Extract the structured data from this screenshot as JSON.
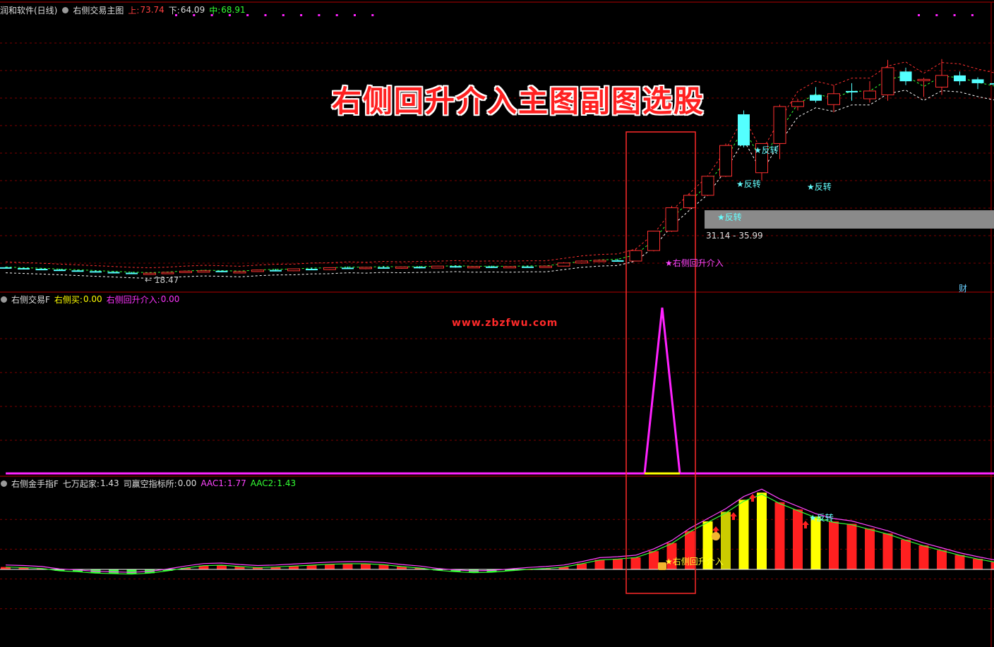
{
  "header": {
    "app_name": "润和软件(日线)",
    "indicator_name": "右侧交易主图",
    "upper_label": "上:",
    "upper_value": "73.74",
    "lower_label": "下:",
    "lower_value": "64.09",
    "mid_label": "中:",
    "mid_value": "68.91"
  },
  "banner": {
    "title": "右侧回升介入主图副图选股"
  },
  "watermark": {
    "text": "www.zbzfwu.com"
  },
  "pane2": {
    "name": "右侧交易F",
    "buy_label": "右侧买:",
    "buy_value": "0.00",
    "rise_label": "右侧回升介入:",
    "rise_value": "0.00"
  },
  "pane3": {
    "name": "右侧金手指F",
    "k1_label": "七万起家:",
    "k1_value": "1.43",
    "k2_label": "司赢空指标所:",
    "k2_value": "0.00",
    "aac1_label": "AAC1:",
    "aac1_value": "1.77",
    "aac2_label": "AAC2:",
    "aac2_value": "1.43"
  },
  "annotations": {
    "low_price": "← 18.47",
    "price_range": "31.14 - 35.99",
    "rise_entry": "★右侧回升介入",
    "reverse": "★反转",
    "cai": "财"
  },
  "colors": {
    "up": "#ff3030",
    "down": "#54ffff",
    "magenta": "#ff22ff",
    "yellow": "#ffff00",
    "grid": "#7a0000"
  },
  "chart_data": [
    {
      "type": "candlestick",
      "title": "右侧交易主图",
      "candles": [
        [
          20.2,
          20.3,
          19.9,
          20.0
        ],
        [
          20.0,
          20.1,
          19.7,
          19.8
        ],
        [
          19.8,
          20.0,
          19.5,
          19.6
        ],
        [
          19.6,
          19.8,
          19.3,
          19.4
        ],
        [
          19.4,
          19.6,
          19.1,
          19.2
        ],
        [
          19.2,
          19.4,
          18.9,
          19.0
        ],
        [
          19.0,
          19.2,
          18.7,
          18.8
        ],
        [
          18.8,
          19.0,
          18.5,
          18.6
        ],
        [
          18.6,
          18.8,
          18.47,
          18.7
        ],
        [
          18.7,
          19.0,
          18.6,
          18.9
        ],
        [
          18.9,
          19.3,
          18.8,
          19.2
        ],
        [
          19.2,
          19.5,
          19.0,
          19.3
        ],
        [
          19.3,
          19.4,
          18.9,
          19.0
        ],
        [
          19.0,
          19.2,
          18.8,
          19.1
        ],
        [
          19.1,
          19.6,
          19.0,
          19.5
        ],
        [
          19.5,
          19.8,
          19.2,
          19.3
        ],
        [
          19.3,
          19.9,
          19.2,
          19.8
        ],
        [
          19.8,
          20.1,
          19.5,
          19.6
        ],
        [
          19.6,
          20.2,
          19.5,
          20.1
        ],
        [
          20.1,
          20.4,
          19.8,
          19.9
        ],
        [
          19.9,
          20.3,
          19.7,
          20.2
        ],
        [
          20.2,
          20.5,
          19.9,
          20.0
        ],
        [
          20.0,
          20.4,
          19.8,
          20.3
        ],
        [
          20.3,
          20.5,
          19.9,
          20.0
        ],
        [
          20.0,
          20.6,
          19.9,
          20.5
        ],
        [
          20.5,
          20.7,
          20.1,
          20.2
        ],
        [
          20.2,
          20.5,
          20.0,
          20.4
        ],
        [
          20.4,
          20.6,
          20.0,
          20.1
        ],
        [
          20.1,
          20.5,
          20.0,
          20.4
        ],
        [
          20.4,
          20.6,
          20.1,
          20.2
        ],
        [
          20.2,
          20.6,
          20.1,
          20.5
        ],
        [
          20.5,
          21.5,
          20.4,
          21.3
        ],
        [
          21.3,
          22.0,
          21.1,
          21.8
        ],
        [
          21.8,
          22.2,
          21.6,
          22.0
        ],
        [
          22.0,
          22.4,
          21.7,
          21.8
        ],
        [
          21.8,
          24.8,
          21.7,
          24.5
        ],
        [
          24.5,
          29.6,
          24.3,
          29.5
        ],
        [
          29.5,
          35.99,
          29.3,
          35.5
        ],
        [
          35.5,
          39.0,
          35.0,
          38.7
        ],
        [
          38.7,
          43.8,
          38.5,
          43.6
        ],
        [
          43.6,
          52.0,
          43.4,
          51.5
        ],
        [
          59.5,
          60.5,
          51.0,
          51.5
        ],
        [
          44.5,
          52.0,
          42.6,
          52.0
        ],
        [
          52.0,
          62.0,
          48.0,
          61.5
        ],
        [
          61.5,
          63.5,
          60.5,
          62.8
        ],
        [
          64.5,
          66.5,
          62.5,
          63.0
        ],
        [
          62.0,
          67.0,
          60.0,
          64.8
        ],
        [
          65.5,
          67.5,
          63.0,
          65.3
        ],
        [
          63.5,
          68.0,
          62.5,
          65.5
        ],
        [
          64.5,
          73.5,
          63.0,
          71.5
        ],
        [
          70.5,
          71.5,
          67.0,
          68.0
        ],
        [
          68.3,
          68.9,
          64.0,
          68.5
        ],
        [
          66.5,
          73.7,
          64.5,
          69.5
        ],
        [
          69.5,
          70.5,
          67.0,
          68.0
        ],
        [
          68.5,
          69.0,
          66.0,
          67.5
        ],
        [
          67.5,
          68.0,
          65.0,
          67.2
        ]
      ],
      "candle_fields": [
        "open",
        "high",
        "low",
        "close"
      ],
      "series": [
        {
          "name": "上",
          "last": 73.74
        },
        {
          "name": "下",
          "last": 64.09
        },
        {
          "name": "中",
          "last": 68.91
        }
      ],
      "ylim": [
        16,
        78
      ]
    },
    {
      "type": "line",
      "title": "右侧交易F",
      "series": [
        {
          "name": "右侧回升介入",
          "values": [
            0,
            0,
            0,
            0,
            0,
            0,
            0,
            0,
            0,
            0,
            0,
            0,
            0,
            0,
            0,
            0,
            0,
            0,
            0,
            0,
            0,
            0,
            0,
            0,
            0,
            0,
            0,
            0,
            0,
            0,
            0,
            0,
            0,
            0,
            0,
            0,
            1,
            0,
            0,
            0,
            0,
            0,
            0,
            0,
            0,
            0,
            0,
            0,
            0,
            0,
            0,
            0,
            0,
            0,
            0,
            0
          ]
        },
        {
          "name": "右侧买",
          "values": [
            0,
            0,
            0,
            0,
            0,
            0,
            0,
            0,
            0,
            0,
            0,
            0,
            0,
            0,
            0,
            0,
            0,
            0,
            0,
            0,
            0,
            0,
            0,
            0,
            0,
            0,
            0,
            0,
            0,
            0,
            0,
            0,
            0,
            0,
            0,
            0,
            0,
            0,
            0,
            0,
            0,
            0,
            0,
            0,
            0,
            0,
            0,
            0,
            0,
            0,
            0,
            0,
            0,
            0,
            0,
            0
          ]
        }
      ]
    },
    {
      "type": "bar",
      "title": "右侧金手指F",
      "values": [
        0.05,
        0.04,
        0.02,
        -0.03,
        -0.05,
        -0.08,
        -0.09,
        -0.1,
        -0.08,
        -0.03,
        0.03,
        0.08,
        0.09,
        0.06,
        0.04,
        0.05,
        0.07,
        0.09,
        0.11,
        0.12,
        0.12,
        0.1,
        0.06,
        0.03,
        -0.02,
        -0.05,
        -0.07,
        -0.06,
        -0.03,
        0.0,
        0.02,
        0.05,
        0.12,
        0.2,
        0.22,
        0.25,
        0.38,
        0.55,
        0.8,
        1.0,
        1.2,
        1.45,
        1.6,
        1.4,
        1.25,
        1.1,
        1.0,
        0.95,
        0.85,
        0.75,
        0.62,
        0.5,
        0.4,
        0.3,
        0.22,
        0.15
      ],
      "highlight": [
        false,
        false,
        false,
        false,
        false,
        false,
        false,
        false,
        false,
        false,
        false,
        false,
        false,
        false,
        false,
        false,
        false,
        false,
        false,
        false,
        false,
        false,
        false,
        false,
        false,
        false,
        false,
        false,
        false,
        false,
        false,
        false,
        false,
        false,
        false,
        false,
        false,
        false,
        false,
        true,
        true,
        true,
        true,
        false,
        false,
        true,
        false,
        false,
        false,
        false,
        false,
        false,
        false,
        false,
        false,
        false
      ],
      "series": [
        {
          "name": "AAC1",
          "last": 1.77
        },
        {
          "name": "AAC2",
          "last": 1.43
        }
      ]
    }
  ]
}
